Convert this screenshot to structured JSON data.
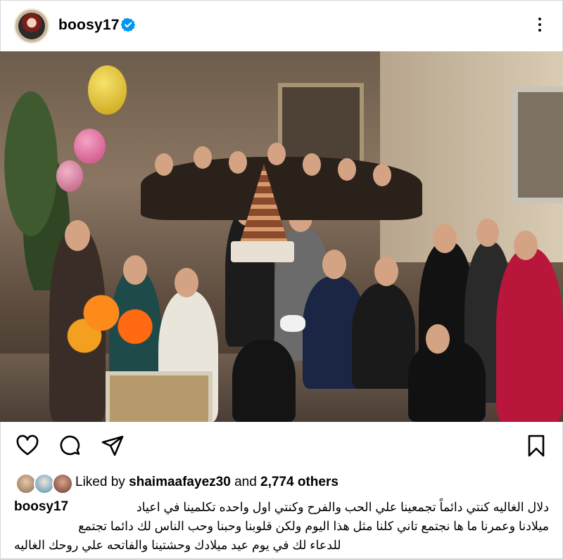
{
  "post": {
    "username": "boosy17",
    "verified": true,
    "more_icon": "more-vertical-icon"
  },
  "actions": {
    "like_icon": "heart-icon",
    "comment_icon": "comment-icon",
    "share_icon": "send-icon",
    "save_icon": "bookmark-icon"
  },
  "likes": {
    "prefix": "Liked by",
    "user": "shaimaafayez30",
    "joiner": "and",
    "count": "2,774 others"
  },
  "caption": {
    "username": "boosy17",
    "line1": "دلال الغاليه كنتي دائماً تجمعينا علي الحب والفرح وكنتي اول واحده تكلمينا في اعياد",
    "line2": "ميلادنا  وعمرنا ما ها نجتمع تاني كلنا مثل هذا اليوم ولكن قلوبنا وحبنا وحب الناس لك دائما تجتمع",
    "line3": "للدعاء لك في يوم عيد ميلادك وحشتينا والفاتحه علي روحك الغاليه"
  },
  "colors": {
    "verified_blue": "#0095f6",
    "text": "#000000",
    "border": "#d8d8d8"
  }
}
